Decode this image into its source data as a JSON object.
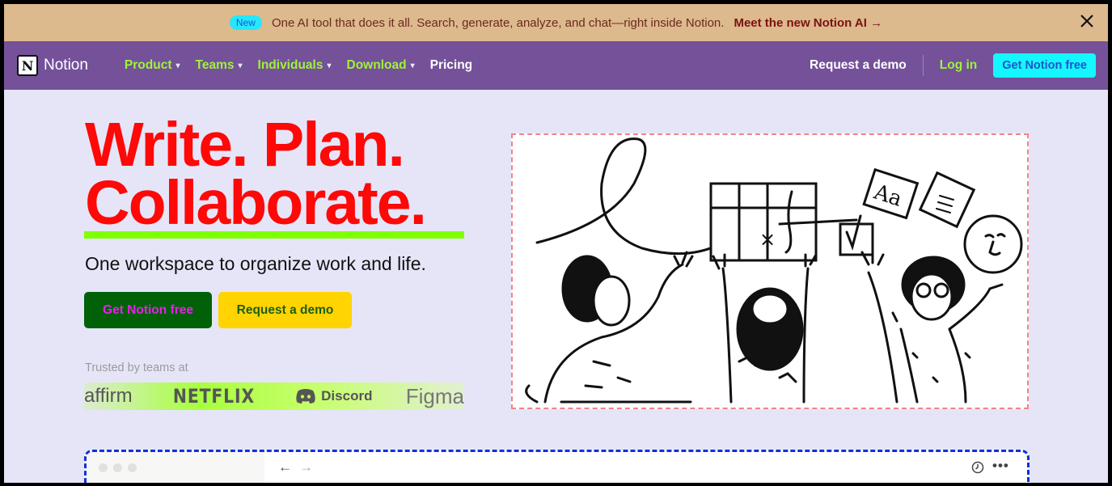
{
  "banner": {
    "badge": "New",
    "message": "One AI tool that does it all. Search, generate, analyze, and chat—right inside Notion.",
    "cta": "Meet the new Notion AI →",
    "close_icon": "close-icon"
  },
  "nav": {
    "logo_letter": "N",
    "brand": "Notion",
    "items": [
      {
        "label": "Product",
        "chevron": "▾"
      },
      {
        "label": "Teams",
        "chevron": "▾"
      },
      {
        "label": "Individuals",
        "chevron": "▾"
      },
      {
        "label": "Download",
        "chevron": "▾"
      },
      {
        "label": "Pricing"
      }
    ],
    "request_demo": "Request a demo",
    "login": "Log in",
    "get_free": "Get Notion free"
  },
  "hero": {
    "headline_line1": "Write. Plan.",
    "headline_line2": "Collaborate.",
    "subhead": "One workspace to organize work and life.",
    "primary_button": "Get Notion free",
    "secondary_button": "Request a demo",
    "trusted_label": "Trusted by teams at",
    "logos": [
      "affirm",
      "NETFLIX",
      "Discord",
      "Figma"
    ]
  },
  "colors": {
    "banner_bg": "#ddb98e",
    "nav_bg": "#745199",
    "page_bg": "#e6e5f8",
    "headline": "#ff0808",
    "accent_green": "#9ef33a",
    "cta_cyan": "#14f7ff",
    "primary_button_bg": "#006108",
    "secondary_button_bg": "#ffd400"
  },
  "preview": {
    "back_icon": "←",
    "forward_icon": "→",
    "history_icon": "clock-icon",
    "more_icon": "•••"
  }
}
